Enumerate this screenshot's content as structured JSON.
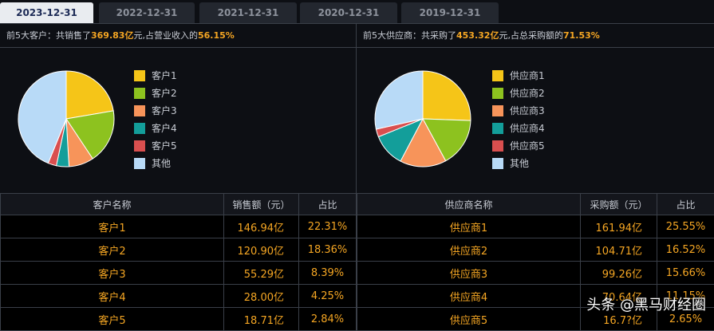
{
  "tabs": [
    {
      "label": "2023-12-31",
      "active": true
    },
    {
      "label": "2022-12-31",
      "active": false
    },
    {
      "label": "2021-12-31",
      "active": false
    },
    {
      "label": "2020-12-31",
      "active": false
    },
    {
      "label": "2019-12-31",
      "active": false
    }
  ],
  "left": {
    "summary": {
      "prefix": "前5大客户：共销售了",
      "amount": "369.83亿",
      "middle": "元,占营业收入的",
      "percent": "56.15%"
    },
    "legend": [
      "客户1",
      "客户2",
      "客户3",
      "客户4",
      "客户5",
      "其他"
    ],
    "columns": [
      "客户名称",
      "销售额（元）",
      "占比"
    ],
    "rows": [
      {
        "name": "客户1",
        "amount": "146.94亿",
        "share": "22.31%"
      },
      {
        "name": "客户2",
        "amount": "120.90亿",
        "share": "18.36%"
      },
      {
        "name": "客户3",
        "amount": "55.29亿",
        "share": "8.39%"
      },
      {
        "name": "客户4",
        "amount": "28.00亿",
        "share": "4.25%"
      },
      {
        "name": "客户5",
        "amount": "18.71亿",
        "share": "2.84%"
      }
    ]
  },
  "right": {
    "summary": {
      "prefix": "前5大供应商：共采购了",
      "amount": "453.32亿",
      "middle": "元,占总采购额的",
      "percent": "71.53%"
    },
    "legend": [
      "供应商1",
      "供应商2",
      "供应商3",
      "供应商4",
      "供应商5",
      "其他"
    ],
    "columns": [
      "供应商名称",
      "采购额（元）",
      "占比"
    ],
    "rows": [
      {
        "name": "供应商1",
        "amount": "161.94亿",
        "share": "25.55%"
      },
      {
        "name": "供应商2",
        "amount": "104.71亿",
        "share": "16.52%"
      },
      {
        "name": "供应商3",
        "amount": "99.26亿",
        "share": "15.66%"
      },
      {
        "name": "供应商4",
        "amount": "70.64亿",
        "share": "11.15%"
      },
      {
        "name": "供应商5",
        "amount": "16.7?亿",
        "share": "2.65%"
      }
    ]
  },
  "colors": [
    "#f5c518",
    "#8dc21f",
    "#f7945a",
    "#139e9a",
    "#d94f4f",
    "#b8daf7"
  ],
  "chart_data": [
    {
      "type": "pie",
      "categories": [
        "客户1",
        "客户2",
        "客户3",
        "客户4",
        "客户5",
        "其他"
      ],
      "values": [
        22.31,
        18.36,
        8.39,
        4.25,
        2.84,
        43.85
      ],
      "legend": "right"
    },
    {
      "type": "pie",
      "categories": [
        "供应商1",
        "供应商2",
        "供应商3",
        "供应商4",
        "供应商5",
        "其他"
      ],
      "values": [
        25.55,
        16.52,
        15.66,
        11.15,
        2.65,
        28.47
      ],
      "legend": "right"
    }
  ],
  "watermark": "头条 @黑马财经圈"
}
